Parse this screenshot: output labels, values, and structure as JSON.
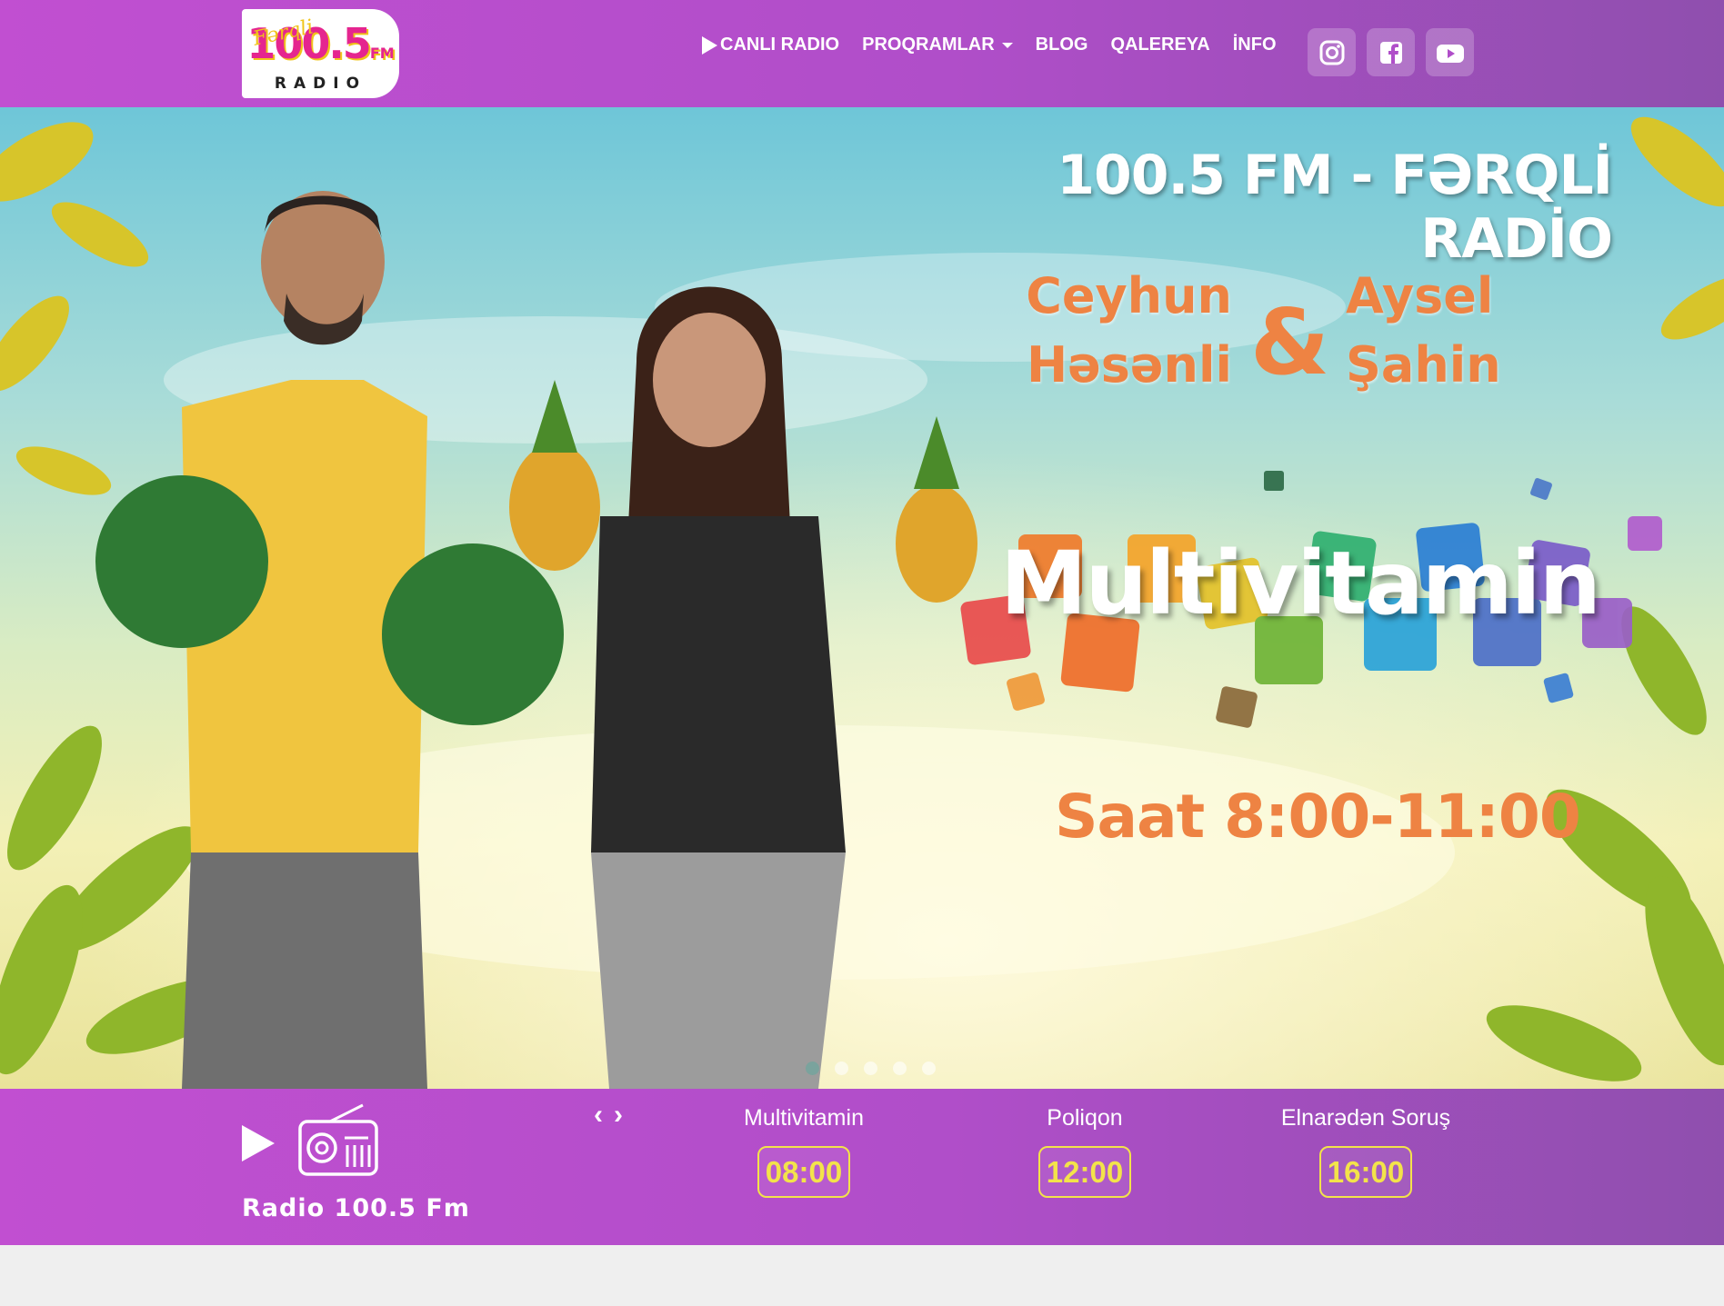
{
  "brand": {
    "logo_script": "Fərqli",
    "logo_number": "100.5",
    "logo_fm": "FM",
    "logo_radio": "RADIO",
    "colors": {
      "primary": "#b94fcd",
      "accent_yellow": "#f3e34a",
      "orange": "#ee8343"
    }
  },
  "nav": {
    "items": [
      {
        "label": "CANLI RADIO",
        "icon": "play-icon"
      },
      {
        "label": "PROQRAMLAR",
        "icon": "caret-down-icon"
      },
      {
        "label": "BLOG"
      },
      {
        "label": "QALEREYA"
      },
      {
        "label": "İNFO"
      }
    ],
    "social": [
      "instagram-icon",
      "facebook-icon",
      "youtube-icon"
    ]
  },
  "hero": {
    "title": "100.5 FM - FƏRQLİ RADİO",
    "host1_first": "Ceyhun",
    "host1_last": "Həsənli",
    "ampersand": "&",
    "host2_first": "Aysel",
    "host2_last": "Şahin",
    "show": "Multivitamin",
    "time": "Saat 8:00-11:00",
    "slides_count": 5,
    "active_slide": 1
  },
  "player": {
    "station": "Radio 100.5 Fm",
    "prev": "‹",
    "next": "›",
    "schedule": [
      {
        "name": "Multivitamin",
        "time": "08:00"
      },
      {
        "name": "Poliqon",
        "time": "12:00"
      },
      {
        "name": "Elnarədən Soruş",
        "time": "16:00"
      }
    ]
  }
}
